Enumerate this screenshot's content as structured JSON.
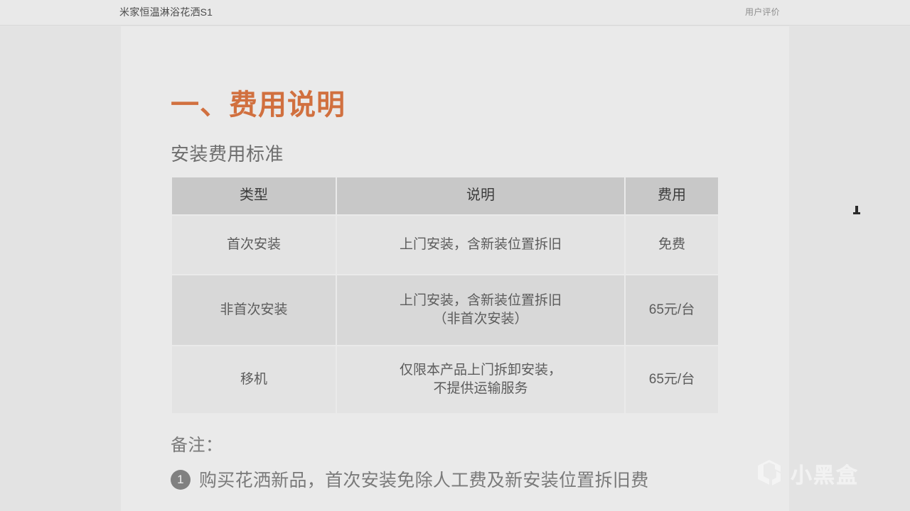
{
  "top_bar": {
    "product_title": "米家恒温淋浴花洒S1",
    "right_link": "用户评价"
  },
  "content": {
    "section_title": "一、费用说明",
    "sub_title": "安装费用标准",
    "table": {
      "headers": [
        "类型",
        "说明",
        "费用"
      ],
      "rows": [
        {
          "type": "首次安装",
          "desc_lines": [
            "上门安装，含新装位置拆旧"
          ],
          "fee": "免费"
        },
        {
          "type": "非首次安装",
          "desc_lines": [
            "上门安装，含新装位置拆旧",
            "（非首次安装）"
          ],
          "fee": "65元/台"
        },
        {
          "type": "移机",
          "desc_lines": [
            "仅限本产品上门拆卸安装，",
            "不提供运输服务"
          ],
          "fee": "65元/台"
        }
      ]
    },
    "notes_label": "备注：",
    "notes": [
      {
        "number": "1",
        "text": "购买花洒新品，首次安装免除人工费及新安装位置拆旧费"
      }
    ]
  },
  "watermark": {
    "text": "小黑盒",
    "logo_icon": "heybox-logo-icon"
  },
  "colors": {
    "page_background": "#e3e3e3",
    "panel_background": "#eaeaea",
    "title_accent": "#d1703f",
    "table_header": "#c8c8c8",
    "row_odd": "#e3e3e3",
    "row_even": "#d8d8d8",
    "body_text": "#5c5c5c"
  }
}
